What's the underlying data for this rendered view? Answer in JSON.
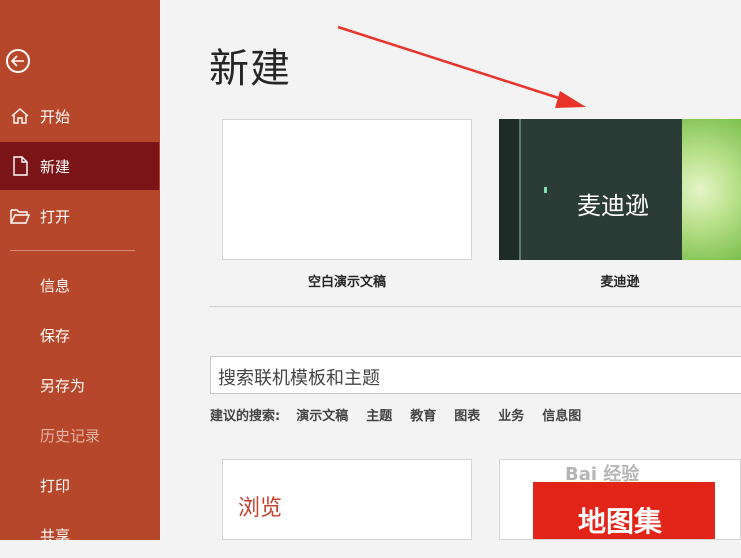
{
  "sidebar": {
    "items": [
      {
        "label": "开始",
        "icon": "home-icon"
      },
      {
        "label": "新建",
        "icon": "new-document-icon"
      },
      {
        "label": "打开",
        "icon": "open-folder-icon"
      },
      {
        "label": "信息"
      },
      {
        "label": "保存"
      },
      {
        "label": "另存为"
      },
      {
        "label": "历史记录"
      },
      {
        "label": "打印"
      },
      {
        "label": "共享"
      }
    ]
  },
  "main": {
    "title": "新建",
    "templates": [
      {
        "label": "空白演示文稿"
      },
      {
        "label": "麦迪逊",
        "thumbnail_title": "麦迪逊"
      }
    ],
    "search": {
      "placeholder": "搜索联机模板和主题"
    },
    "suggested": {
      "label": "建议的搜索:",
      "tags": [
        "演示文稿",
        "主题",
        "教育",
        "图表",
        "业务",
        "信息图"
      ]
    },
    "bottom_cards": [
      {
        "label": "浏览"
      },
      {
        "label": "地图集"
      }
    ]
  },
  "watermark": "Bai 经验",
  "colors": {
    "sidebar": "#b7472a",
    "active": "#7b1416",
    "arrow": "#e8342b"
  }
}
